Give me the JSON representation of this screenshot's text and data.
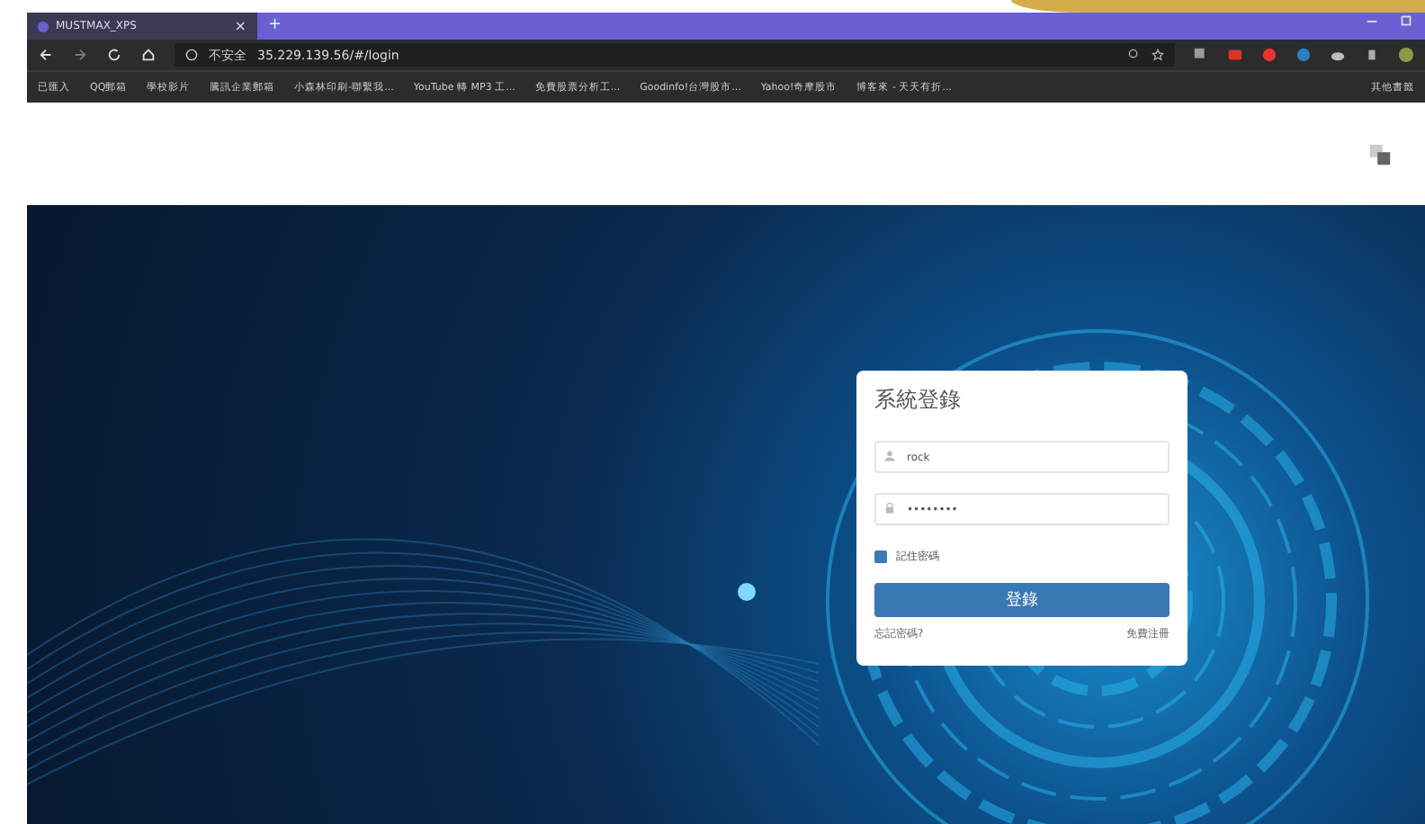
{
  "browser": {
    "tab": {
      "title": "MUSTMAX_XPS",
      "close": "×",
      "new_tab": "+"
    },
    "address": {
      "security": "不安全",
      "url": "35.229.139.56/#/login"
    },
    "bookmarks": [
      "已匯入",
      "QQ郵箱",
      "學校影片",
      "騰訊企業郵箱",
      "小森林印刷-聯繫我...",
      "YouTube 轉 MP3 工...",
      "免費股票分析工...",
      "Goodinfo!台灣股市...",
      "Yahoo!奇摩股市",
      "博客來 - 天天有折..."
    ],
    "other_bookmarks": "其他書籤"
  },
  "login": {
    "title": "系統登錄",
    "username": "rock",
    "password": "••••••••",
    "remember": {
      "label": "記住密碼",
      "checked": true
    },
    "submit": "登錄",
    "forgot": "忘記密碼?",
    "register": "免費注冊"
  }
}
